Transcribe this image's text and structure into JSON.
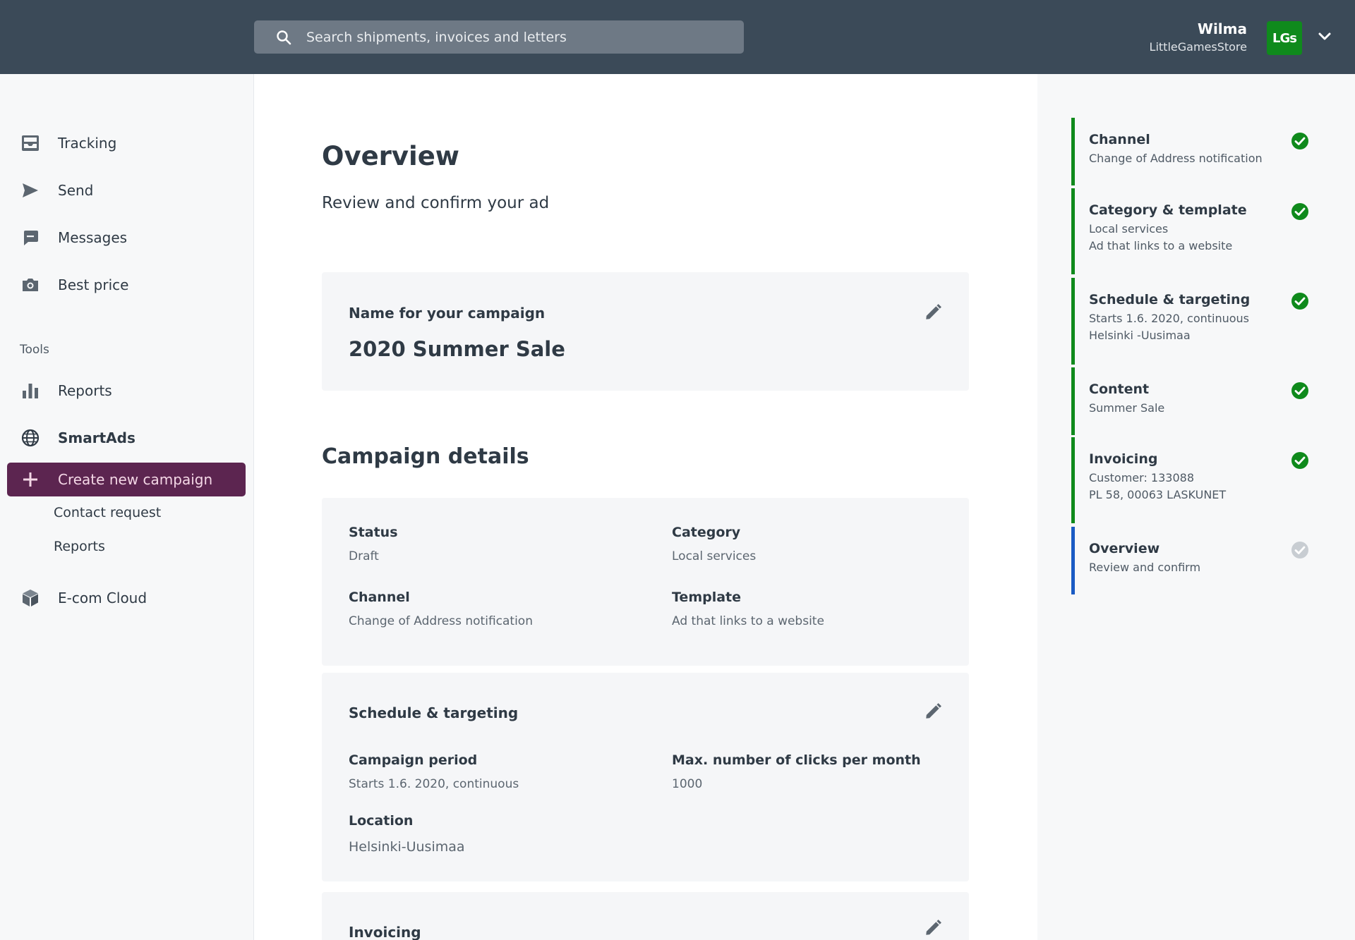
{
  "header": {
    "search_placeholder": "Search shipments, invoices and letters",
    "user_name": "Wilma",
    "user_company": "LittleGamesStore",
    "avatar_text": "LGs",
    "accent_color": "#3b4a58"
  },
  "sidebar": {
    "items": [
      {
        "label": "Tracking",
        "icon": "inbox-tray-icon"
      },
      {
        "label": "Send",
        "icon": "send-arrow-icon"
      },
      {
        "label": "Messages",
        "icon": "chat-bubble-icon"
      },
      {
        "label": "Best price",
        "icon": "camera-icon"
      }
    ],
    "tools_label": "Tools",
    "reports_label": "Reports",
    "smartads_label": "SmartAds",
    "create_campaign_label": "Create new campaign",
    "contact_request_label": "Contact request",
    "sub_reports_label": "Reports",
    "ecom_label": "E-com Cloud",
    "active_color": "#5c2550"
  },
  "main": {
    "title": "Overview",
    "subtitle": "Review and confirm your ad",
    "name_card": {
      "label": "Name for your campaign",
      "value": "2020 Summer Sale"
    },
    "details_title": "Campaign details",
    "details": {
      "status_label": "Status",
      "status_value": "Draft",
      "category_label": "Category",
      "category_value": "Local services",
      "channel_label": "Channel",
      "channel_value": "Change of Address notification",
      "template_label": "Template",
      "template_value": "Ad that links to a website"
    },
    "schedule": {
      "title": "Schedule & targeting",
      "period_label": "Campaign period",
      "period_value": "Starts 1.6. 2020, continuous",
      "clicks_label": "Max. number of clicks per month",
      "clicks_value": "1000",
      "location_label": "Location",
      "location_value": "Helsinki-Uusimaa"
    },
    "invoicing_title": "Invoicing"
  },
  "steps": [
    {
      "title": "Channel",
      "lines": [
        "Change of Address notification"
      ],
      "done": true
    },
    {
      "title": "Category & template",
      "lines": [
        "Local services",
        "Ad that links to a website"
      ],
      "done": true
    },
    {
      "title": "Schedule & targeting",
      "lines": [
        "Starts 1.6. 2020, continuous",
        "Helsinki -Uusimaa"
      ],
      "done": true
    },
    {
      "title": "Content",
      "lines": [
        "Summer Sale"
      ],
      "done": true
    },
    {
      "title": "Invoicing",
      "lines": [
        "Customer: 133088",
        "PL 58, 00063 LASKUNET"
      ],
      "done": true
    },
    {
      "title": "Overview",
      "lines": [
        "Review and confirm"
      ],
      "done": false
    }
  ],
  "colors": {
    "done_green": "#0f8a1c",
    "current_blue": "#1a5bc4",
    "pending_gray": "#c8cdd2"
  }
}
